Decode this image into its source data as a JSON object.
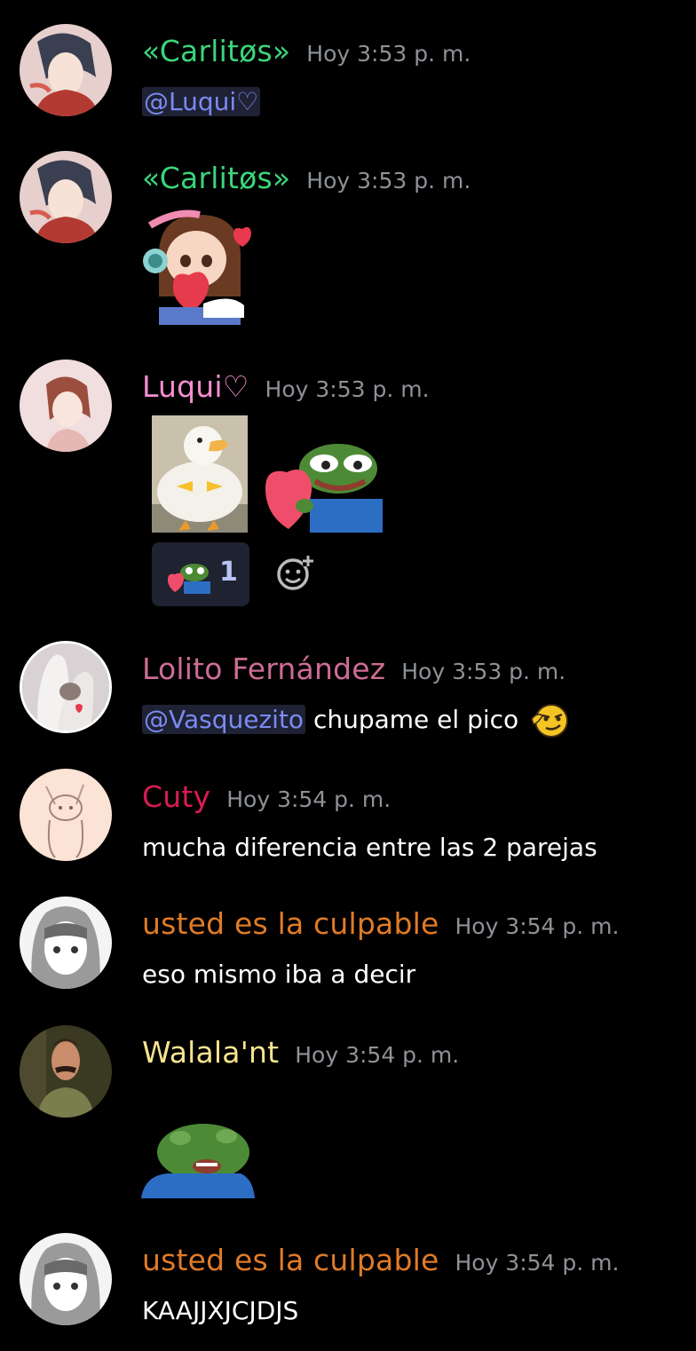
{
  "colors": {
    "background": "#000000",
    "timestamp": "#8e9297",
    "mention_bg": "#1e2234",
    "mention_fg": "#7c8af2"
  },
  "messages": [
    {
      "author": "«Carlitøs»",
      "author_color": "#3bd57a",
      "timestamp": "Hoy 3:53 p. m.",
      "mention": "@Luqui♡",
      "avatar_icon": "anime-boy-avatar"
    },
    {
      "author": "«Carlitøs»",
      "author_color": "#3bd57a",
      "timestamp": "Hoy 3:53 p. m.",
      "sticker": "dva-heart-sticker",
      "avatar_icon": "anime-boy-avatar"
    },
    {
      "author": "Luqui♡",
      "author_color": "#f68fcf",
      "timestamp": "Hoy 3:53 p. m.",
      "stickers": [
        "duck-sticker",
        "pepe-heart-sticker"
      ],
      "reaction": {
        "emoji": "pepe-heart-emoji",
        "count": "1"
      },
      "avatar_icon": "anime-girl-avatar"
    },
    {
      "author": "Lolito Fernández",
      "author_color": "#cd6d93",
      "timestamp": "Hoy 3:53 p. m.",
      "mention": "@Vasquezito",
      "text": " chupame el pico",
      "emoji": "smirk-face-emoji",
      "avatar_icon": "cat-avatar"
    },
    {
      "author": "Cuty",
      "author_color": "#d81b54",
      "timestamp": "Hoy 3:54 p. m.",
      "text": "mucha diferencia entre las 2 parejas",
      "avatar_icon": "creature-sketch-avatar"
    },
    {
      "author": "usted es la culpable",
      "author_color": "#e07b27",
      "timestamp": "Hoy 3:54 p. m.",
      "text": "eso mismo iba a decir",
      "avatar_icon": "manga-girl-avatar"
    },
    {
      "author": "Walala'nt",
      "author_color": "#f8e48f",
      "timestamp": "Hoy 3:54 p. m.",
      "sticker": "pepe-shocked-sticker",
      "avatar_icon": "man-mustache-avatar"
    },
    {
      "author": "usted es la culpable",
      "author_color": "#e07b27",
      "timestamp": "Hoy 3:54 p. m.",
      "text": "KAAJJXJCJDJS",
      "avatar_icon": "manga-girl-avatar"
    }
  ]
}
